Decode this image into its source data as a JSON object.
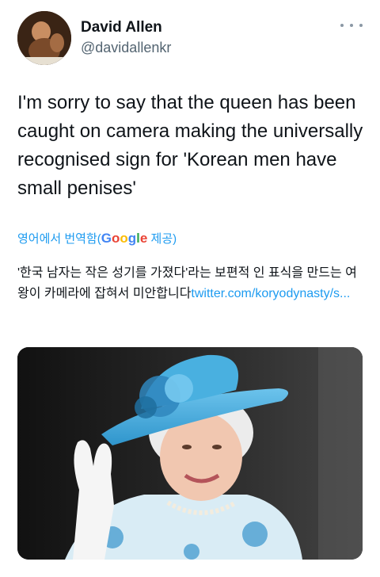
{
  "author": {
    "name": "David Allen",
    "handle": "@davidallenkr"
  },
  "tweet": {
    "text": "I'm sorry to say that the queen has been caught on camera making the universally recognised sign for 'Korean men have small penises'"
  },
  "translation": {
    "label_prefix": "영어에서 번역함(",
    "google_letters": [
      "G",
      "o",
      "o",
      "g",
      "l",
      "e"
    ],
    "label_suffix": " 제공)",
    "text": "'한국 남자는 작은 성기를 가졌다'라는 보편적 인 표식을 만드는 여왕이 카메라에 잡혀서 미안합니다",
    "link": "twitter.com/koryodynasty/s..."
  },
  "icons": {
    "more": "more-horizontal-icon"
  },
  "colors": {
    "link": "#1d9bf0",
    "secondary_text": "#536471",
    "hat": "#3fa8d8"
  }
}
